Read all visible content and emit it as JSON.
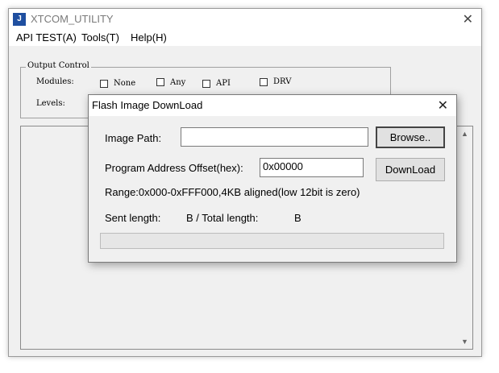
{
  "window": {
    "title": "XTCOM_UTILITY",
    "close_glyph": "✕",
    "icon": "app-logo-icon"
  },
  "menu": {
    "items": [
      "API TEST(A)",
      "Tools(T)",
      "Help(H)"
    ]
  },
  "output_control": {
    "legend": "Output Control",
    "modules_label": "Modules:",
    "levels_label": "Levels:",
    "modules": [
      {
        "label": "None",
        "checked": false
      },
      {
        "label": "Any",
        "checked": false
      },
      {
        "label": "API",
        "checked": false
      },
      {
        "label": "DRV",
        "checked": false
      }
    ]
  },
  "dialog": {
    "title": "Flash Image DownLoad",
    "close_glyph": "✕",
    "image_path_label": "Image Path:",
    "image_path_value": "",
    "browse_label": "Browse..",
    "offset_label": "Program Address Offset(hex):",
    "offset_value": "0x00000",
    "download_label": "DownLoad",
    "range_text": "Range:0x000-0xFFF000,4KB aligned(low 12bit is zero)",
    "sent_length_label": "Sent length:",
    "sent_total_text": "B / Total length:",
    "total_unit": "B",
    "progress": 0
  }
}
